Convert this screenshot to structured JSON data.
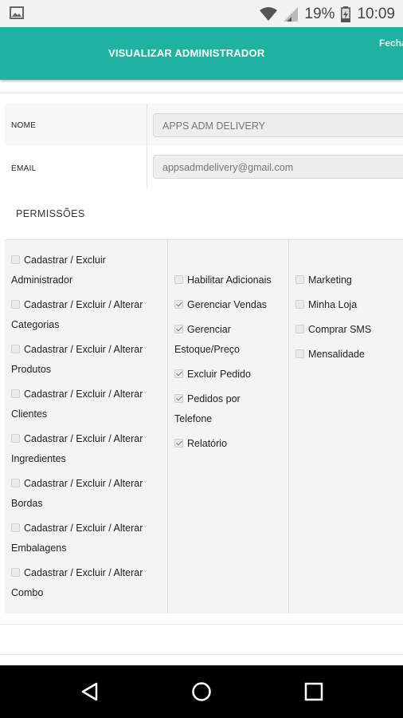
{
  "status_bar": {
    "battery": "19%",
    "time": "10:09",
    "icons": [
      "image-icon",
      "wifi-icon",
      "signal-icon",
      "battery-icon"
    ]
  },
  "app_bar": {
    "title": "VISUALIZAR ADMINISTRADOR",
    "close_label": "Fechar",
    "color": "#20b2a1"
  },
  "form": {
    "name_label": "NOME",
    "name_value": "APPS ADM DELIVERY",
    "email_label": "EMAIL",
    "email_value": "appsadmdelivery@gmail.com"
  },
  "permissions": {
    "title": "PERMISSÕES",
    "col1": [
      {
        "line1": "Cadastrar / Excluir",
        "line2": "Administrador",
        "checked": false
      },
      {
        "line1": "Cadastrar / Excluir / Alterar",
        "line2": "Categorias",
        "checked": false
      },
      {
        "line1": "Cadastrar / Excluir / Alterar",
        "line2": "Produtos",
        "checked": false
      },
      {
        "line1": "Cadastrar / Excluir / Alterar",
        "line2": "Clientes",
        "checked": false
      },
      {
        "line1": "Cadastrar / Excluir / Alterar",
        "line2": "Ingredientes",
        "checked": false
      },
      {
        "line1": "Cadastrar / Excluir / Alterar",
        "line2": "Bordas",
        "checked": false
      },
      {
        "line1": "Cadastrar / Excluir / Alterar",
        "line2": "Embalagens",
        "checked": false
      },
      {
        "line1": "Cadastrar / Excluir / Alterar",
        "line2": "Combo",
        "checked": false
      }
    ],
    "col2": [
      {
        "line1": "Habilitar Adicionais",
        "line2": "",
        "checked": false
      },
      {
        "line1": "Gerenciar Vendas",
        "line2": "",
        "checked": true
      },
      {
        "line1": "Gerenciar",
        "line2": "Estoque/Preço",
        "checked": true
      },
      {
        "line1": "Excluir Pedido",
        "line2": "",
        "checked": true
      },
      {
        "line1": "Pedidos por",
        "line2": "Telefone",
        "checked": true
      },
      {
        "line1": "Relatório",
        "line2": "",
        "checked": true
      }
    ],
    "col3": [
      {
        "line1": "Marketing",
        "line2": "",
        "checked": false
      },
      {
        "line1": "Minha Loja",
        "line2": "",
        "checked": false
      },
      {
        "line1": "Comprar SMS",
        "line2": "",
        "checked": false
      },
      {
        "line1": "Mensalidade",
        "line2": "",
        "checked": false
      }
    ]
  },
  "nav_bar": {
    "icons": [
      "back-icon",
      "home-icon",
      "recents-icon"
    ]
  }
}
